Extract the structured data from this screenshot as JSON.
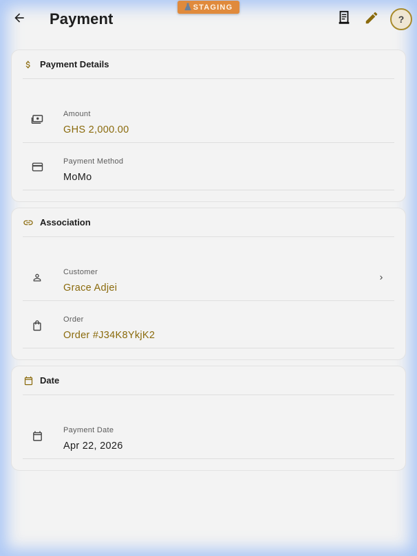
{
  "appbar": {
    "title": "Payment",
    "staging_label": "STAGING",
    "help_label": "?"
  },
  "colors": {
    "accent": "#8a6a0c",
    "badge": "#e08a3c",
    "icon": "#444444"
  },
  "icons": {
    "back": "arrow-left-icon",
    "receipt": "receipt-icon",
    "edit": "pencil-icon",
    "help": "question-icon",
    "payment_details": "dollar-icon",
    "amount": "cash-icon",
    "method": "credit-card-icon",
    "association": "link-icon",
    "customer": "person-icon",
    "order": "shopping-bag-icon",
    "date_section": "calendar-icon",
    "payment_date": "calendar-icon",
    "customer_chevron": "chevron-right-icon"
  },
  "payment_details": {
    "title": "Payment Details",
    "amount_label": "Amount",
    "amount_value": "GHS 2,000.00",
    "method_label": "Payment Method",
    "method_value": "MoMo"
  },
  "association": {
    "title": "Association",
    "customer_label": "Customer",
    "customer_value": "Grace Adjei",
    "order_label": "Order",
    "order_value": "Order #J34K8YkjK2"
  },
  "date": {
    "title": "Date",
    "payment_date_label": "Payment Date",
    "payment_date_value": "Apr 22, 2026"
  }
}
